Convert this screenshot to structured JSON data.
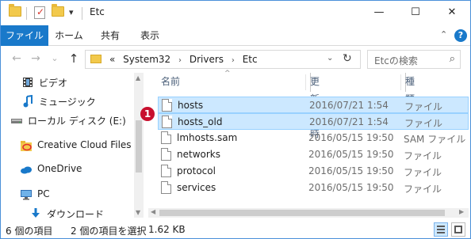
{
  "window": {
    "title": "Etc",
    "quick_access_dropdown": "▾",
    "controls": {
      "minimize": "—",
      "maximize": "☐",
      "close": "✕"
    }
  },
  "ribbon": {
    "tabs": [
      {
        "label": "ファイル",
        "active": true
      },
      {
        "label": "ホーム"
      },
      {
        "label": "共有"
      },
      {
        "label": "表示"
      }
    ],
    "collapse_glyph": "⌃",
    "help_glyph": "?"
  },
  "addressbar": {
    "back": "←",
    "forward": "→",
    "recent": "⌄",
    "up": "↑",
    "overflow": "«",
    "crumbs": [
      "System32",
      "Drivers",
      "Etc"
    ],
    "crumb_sep": "›",
    "dropdown": "⌄",
    "refresh": "↻"
  },
  "search": {
    "placeholder": "Etcの検索",
    "icon": "⌕"
  },
  "nav": {
    "items": [
      {
        "label": "ビデオ",
        "icon": "video-icon"
      },
      {
        "label": "ミュージック",
        "icon": "music-icon"
      },
      {
        "label": "ローカル ディスク (E:)",
        "icon": "drive-icon"
      },
      {
        "label": "Creative Cloud Files",
        "icon": "creative-cloud-icon"
      },
      {
        "label": "OneDrive",
        "icon": "onedrive-icon"
      },
      {
        "label": "PC",
        "icon": "pc-icon"
      },
      {
        "label": "ダウンロード",
        "icon": "download-icon"
      }
    ]
  },
  "columns": {
    "name": "名前",
    "date": "更新日時",
    "type": "種類"
  },
  "files": [
    {
      "name": "hosts",
      "date": "2016/07/21 1:54",
      "type": "ファイル",
      "selected": true
    },
    {
      "name": "hosts_old",
      "date": "2016/07/21 1:54",
      "type": "ファイル",
      "selected": true
    },
    {
      "name": "lmhosts.sam",
      "date": "2016/05/15 19:50",
      "type": "SAM ファイル",
      "selected": false
    },
    {
      "name": "networks",
      "date": "2016/05/15 19:50",
      "type": "ファイル",
      "selected": false
    },
    {
      "name": "protocol",
      "date": "2016/05/15 19:50",
      "type": "ファイル",
      "selected": false
    },
    {
      "name": "services",
      "date": "2016/05/15 19:50",
      "type": "ファイル",
      "selected": false
    }
  ],
  "callout": "1",
  "status": {
    "count": "6 個の項目",
    "selected": "2 個の項目を選択",
    "size": "1.62 KB"
  },
  "colors": {
    "accent": "#1979ca",
    "selection": "#cce8ff",
    "selection_border": "#99d1ff",
    "badge": "#c8102e"
  }
}
